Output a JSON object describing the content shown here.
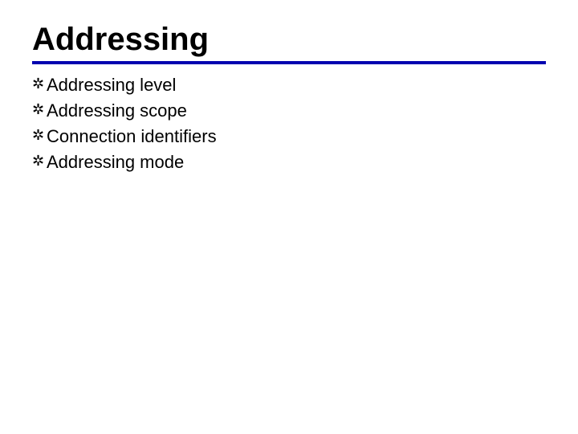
{
  "title": "Addressing",
  "bullet_glyph": "✲",
  "items": [
    {
      "text": "Addressing level"
    },
    {
      "text": "Addressing scope"
    },
    {
      "text": "Connection identifiers"
    },
    {
      "text": "Addressing mode"
    }
  ],
  "colors": {
    "rule": "#0303b0",
    "text": "#000000",
    "background": "#ffffff"
  }
}
